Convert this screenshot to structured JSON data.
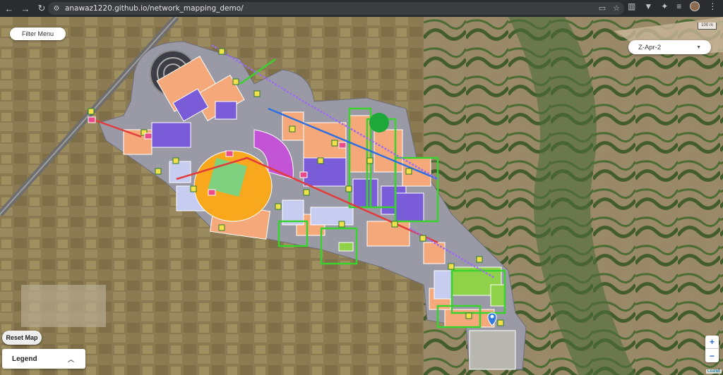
{
  "browser": {
    "url": "anawaz1220.github.io/network_mapping_demo/",
    "back_icon": "arrow-left-icon",
    "forward_icon": "arrow-right-icon",
    "reload_icon": "reload-icon",
    "site_info_icon": "site-info-icon",
    "cast_icon": "cast-icon",
    "bookmark_icon": "star-icon",
    "menu_icon": "kebab-menu-icon"
  },
  "map": {
    "filter_menu_label": "Filter Menu",
    "layer_select": {
      "selected": "Z-Apr-2"
    },
    "scale_label": "100 m",
    "reset_label": "Reset Map",
    "legend_label": "Legend",
    "zoom_in": "+",
    "zoom_out": "−",
    "attribution": "Leaflet",
    "colors": {
      "plot_orange": "#f5a97a",
      "plot_purple": "#7a5bd8",
      "plot_magenta": "#c454d6",
      "plot_lightblue": "#c6cdf0",
      "plot_green": "#8fd24a",
      "boundary_green": "#3ad22e",
      "road_red": "#e23b3b",
      "road_blue": "#2c6fe0",
      "plaza_yellow": "#f7a81c",
      "site_grey": "#9a9aa6"
    }
  }
}
